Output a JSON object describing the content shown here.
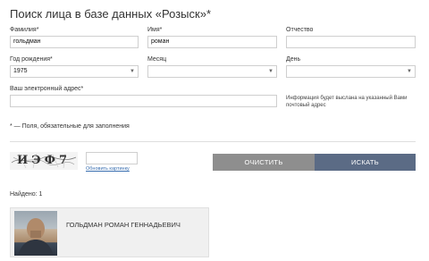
{
  "page": {
    "title": "Поиск лица в базе данных «Розыск»*"
  },
  "form": {
    "surname_label": "Фамилия*",
    "surname_value": "гольдман",
    "name_label": "Имя*",
    "name_value": "роман",
    "patronymic_label": "Отчество",
    "patronymic_value": "",
    "birth_year_label": "Год рождения*",
    "birth_year_value": "1975",
    "month_label": "Месяц",
    "month_value": "",
    "day_label": "День",
    "day_value": "",
    "email_label": "Ваш электронный адрес*",
    "email_value": "",
    "email_info": "Информация будет выслана на указанный Вами почтовый адрес",
    "required_note": "* — Поля, обязательные для заполнения"
  },
  "captcha": {
    "image_text": "ИЭФ7",
    "input_value": "",
    "refresh_link": "Обновить картинку"
  },
  "buttons": {
    "clear_label": "ОЧИСТИТЬ",
    "search_label": "ИСКАТЬ"
  },
  "results": {
    "found_label": "Найдено: 1",
    "items": [
      {
        "name": "ГОЛЬДМАН РОМАН ГЕННАДЬЕВИЧ"
      }
    ]
  },
  "colors": {
    "clear_button": "#8e8e8e",
    "search_button": "#5b6b85",
    "link": "#3a6fb0"
  }
}
